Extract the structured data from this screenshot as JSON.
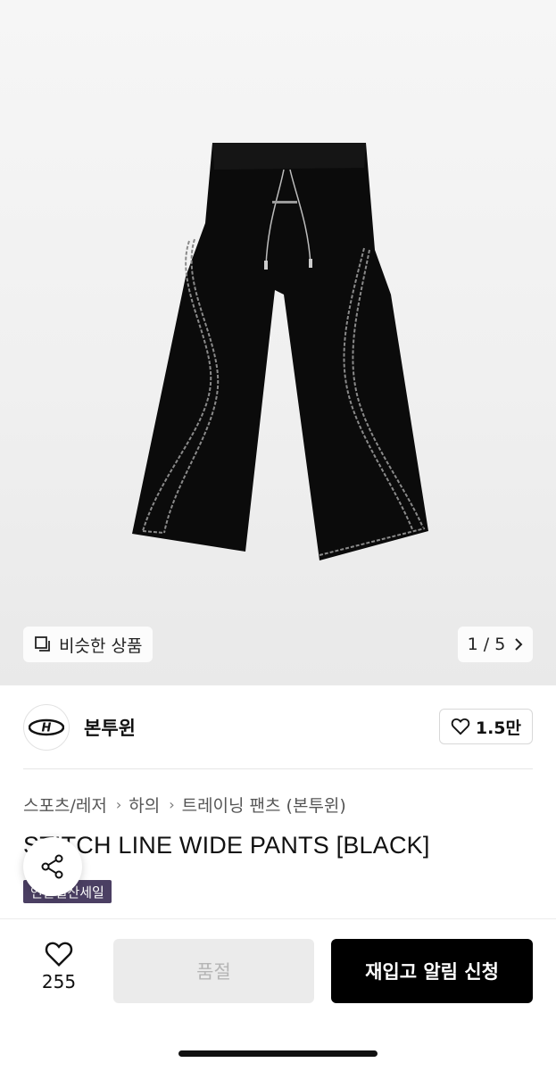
{
  "gallery": {
    "similar_label": "비슷한 상품",
    "pager_text": "1 / 5",
    "image_alt": "STITCH LINE WIDE PANTS [BLACK]"
  },
  "brand": {
    "name": "본투윈",
    "logo_text": "H",
    "like_count": "1.5만"
  },
  "breadcrumb": [
    "스포츠/레저",
    "하의",
    "트레이닝 팬츠 (본투윈)"
  ],
  "product": {
    "title": "STITCH LINE WIDE PANTS [BLACK]",
    "sale_tag": "연말결산세일"
  },
  "bottom_bar": {
    "wish_count": "255",
    "soldout_label": "품절",
    "restock_label": "재입고 알림 신청"
  },
  "icons": {
    "similar": "similar-items-icon",
    "pager": "chevron-right-icon",
    "like": "heart-icon",
    "share": "share-icon",
    "breadcrumb_sep": "chevron-right-icon"
  },
  "colors": {
    "accent_button": "#000000",
    "sale_tag": "#4b3f63",
    "disabled_button": "#ebebeb"
  }
}
